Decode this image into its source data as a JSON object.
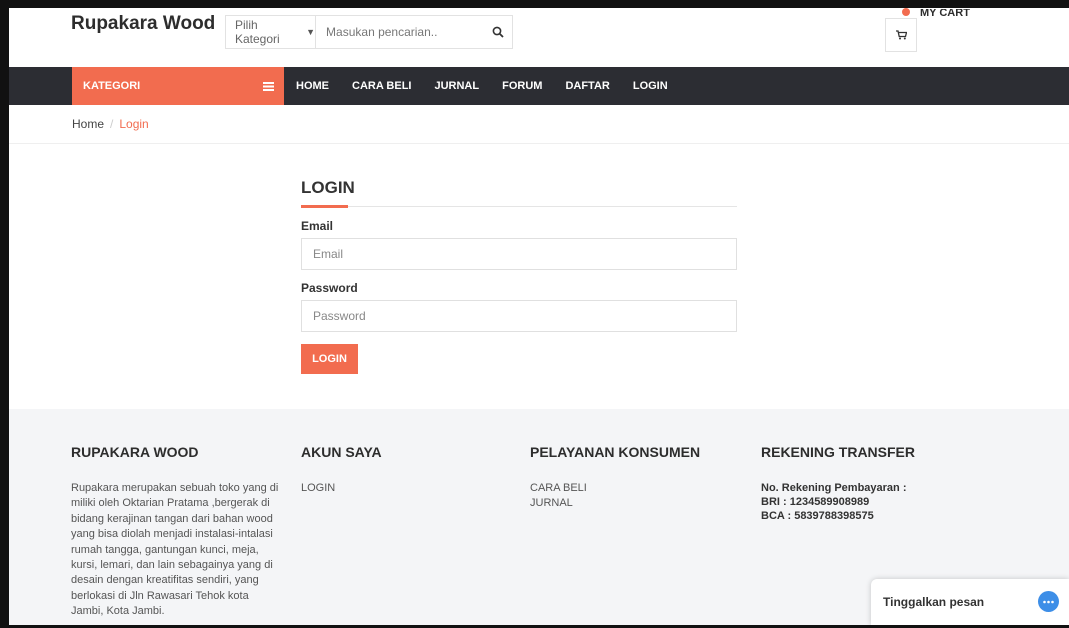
{
  "header": {
    "brand": "Rupakara Wood",
    "search": {
      "category_label": "Pilih Kategori",
      "placeholder": "Masukan pencarian.."
    },
    "cart_label": "MY CART"
  },
  "nav": {
    "kategori_label": "KATEGORI",
    "items": [
      "HOME",
      "CARA BELI",
      "JURNAL",
      "FORUM",
      "DAFTAR",
      "LOGIN"
    ]
  },
  "breadcrumb": {
    "home": "Home",
    "separator": "/",
    "current": "Login"
  },
  "login": {
    "title": "LOGIN",
    "email_label": "Email",
    "email_placeholder": "Email",
    "password_label": "Password",
    "password_placeholder": "Password",
    "button_label": "LOGIN"
  },
  "footer": {
    "about": {
      "title": "RUPAKARA WOOD",
      "text": "Rupakara merupakan sebuah toko yang di miliki oleh Oktarian Pratama ,bergerak di bidang kerajinan tangan dari bahan wood yang bisa diolah menjadi instalasi-intalasi rumah tangga, gantungan kunci, meja, kursi, lemari, dan lain sebagainya yang di desain dengan kreatifitas sendiri, yang berlokasi di Jln Rawasari Tehok kota Jambi, Kota Jambi."
    },
    "account": {
      "title": "AKUN SAYA",
      "links": [
        "LOGIN"
      ]
    },
    "service": {
      "title": "PELAYANAN KONSUMEN",
      "links": [
        "CARA BELI",
        "JURNAL"
      ]
    },
    "bank": {
      "title": "REKENING TRANSFER",
      "lines": [
        "No. Rekening Pembayaran :",
        "BRI : 1234589908989",
        "BCA : 5839788398575"
      ]
    }
  },
  "chat": {
    "label": "Tinggalkan pesan"
  },
  "colors": {
    "accent": "#f26c4f",
    "navbar": "#2c2d33",
    "footer_bg": "#f4f5f7",
    "chat_icon": "#3d8ee7"
  }
}
